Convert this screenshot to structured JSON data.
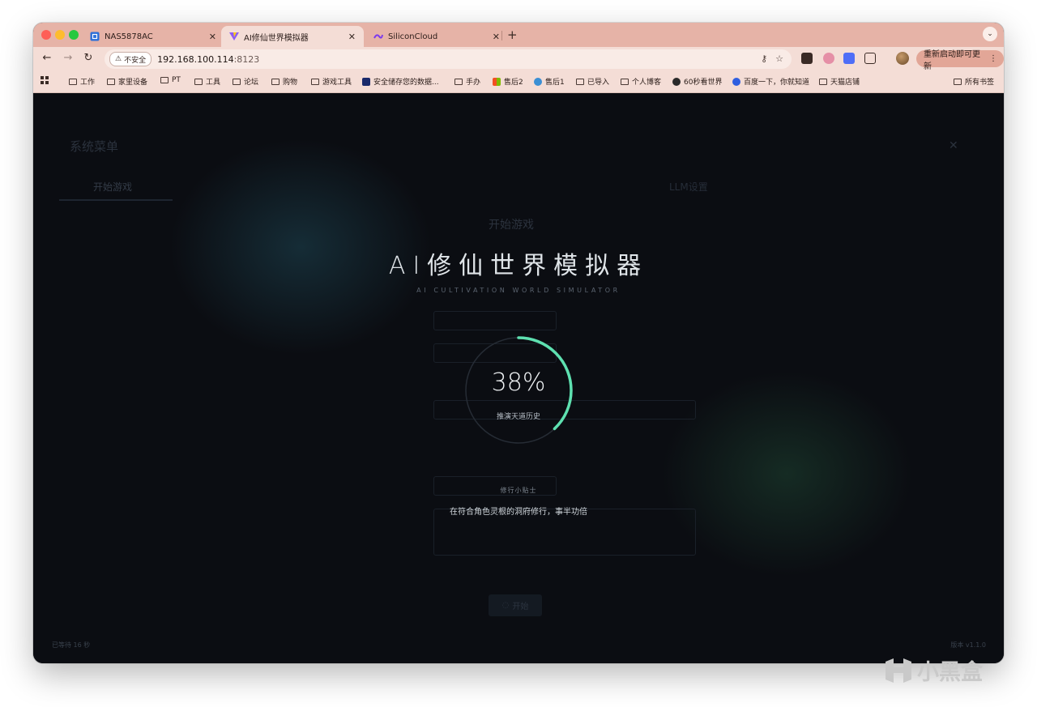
{
  "browser": {
    "tabs": [
      {
        "label": "NAS5878AC",
        "icon": "nas-icon"
      },
      {
        "label": "AI修仙世界模拟器",
        "icon": "vite-icon"
      },
      {
        "label": "SiliconCloud",
        "icon": "siliconcloud-icon"
      }
    ],
    "new_tab_label": "+",
    "address": {
      "insecure_label": "不安全",
      "host": "192.168.100.114",
      "port": ":8123"
    },
    "update_button_label": "重新启动即可更新",
    "bookmarks": [
      "工作",
      "家里设备",
      "PT",
      "工具",
      "论坛",
      "购物",
      "游戏工具",
      "安全储存您的数据...",
      "手办",
      "售后2",
      "售后1",
      "已导入",
      "个人博客",
      "60秒看世界",
      "百度一下，你就知道",
      "天猫店铺",
      "所有书签"
    ]
  },
  "app": {
    "menu_title": "系统菜单",
    "menu_tabs": [
      "开始游戏",
      "LLM设置"
    ],
    "section_title": "开始游戏",
    "start_button_label": "开始",
    "loading": {
      "title": "AI修仙世界模拟器",
      "subtitle": "AI CULTIVATION WORLD SIMULATOR",
      "percent_text": "38%",
      "progress": 0.38,
      "stage": "推演天道历史",
      "tip_label": "修行小贴士",
      "tip_text": "在符合角色灵根的洞府修行，事半功倍"
    },
    "wait_text": "已等待 16 秒",
    "version": "版本 v1.1.0"
  },
  "watermark": {
    "text": "小黑盒"
  },
  "colors": {
    "tab_strip": "#e6b3a7",
    "toolbar": "#f4ddd6",
    "ring_accent": "#5ee0b0",
    "background": "#0b0d12"
  }
}
